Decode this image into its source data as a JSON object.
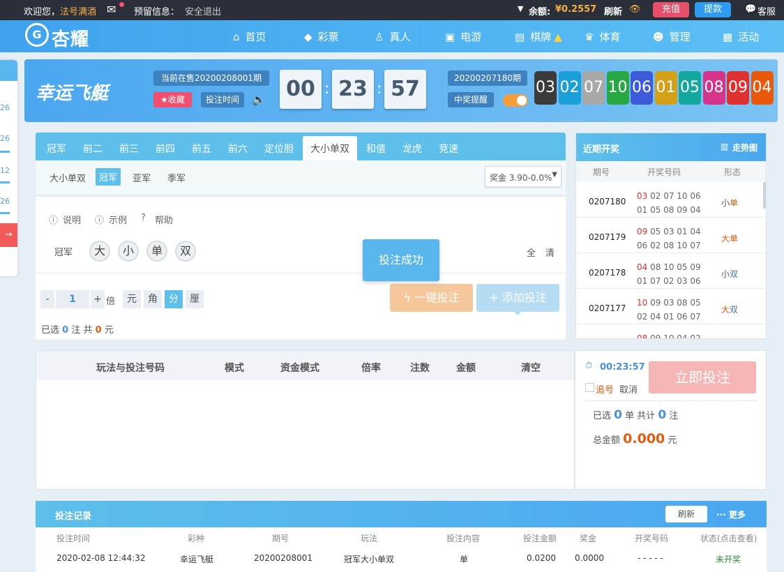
{
  "topbar": {
    "welcome": "欢迎您，",
    "username": "法号满酒",
    "reserved_label": "预留信息：",
    "logout": "安全退出",
    "balance_label": "余额:",
    "balance": "¥0.2557",
    "refresh": "刷新",
    "recharge": "充值",
    "withdraw": "提款",
    "service": "客服"
  },
  "brand": {
    "logo": "杏耀"
  },
  "nav": {
    "items": [
      {
        "label": "首页",
        "icon": "home-icon"
      },
      {
        "label": "彩票",
        "icon": "diamond-icon"
      },
      {
        "label": "真人",
        "icon": "person-icon"
      },
      {
        "label": "电游",
        "icon": "arcade-icon"
      },
      {
        "label": "棋牌",
        "icon": "cards-icon"
      },
      {
        "label": "体育",
        "icon": "trophy-icon"
      },
      {
        "label": "管理",
        "icon": "users-icon"
      },
      {
        "label": "活动",
        "icon": "gift-icon"
      }
    ]
  },
  "side": {
    "values": [
      "26",
      "26",
      "12",
      "26"
    ]
  },
  "game": {
    "title": "幸运飞艇",
    "current_issue": "当前在售20200208001期",
    "favorite": "★收藏",
    "bet_time": "投注时间",
    "countdown": [
      "00",
      "23",
      "57"
    ],
    "last_issue": "20200207180期",
    "win_notice": "中奖提醒",
    "balls": [
      "03",
      "02",
      "07",
      "10",
      "06",
      "01",
      "05",
      "08",
      "09",
      "04"
    ],
    "ball_colors": [
      "#3b3b3b",
      "#1a9fd8",
      "#a8a8a8",
      "#28a745",
      "#3b5bdb",
      "#d4a017",
      "#13a89e",
      "#d6338b",
      "#e03131",
      "#e8590c"
    ]
  },
  "tabs": [
    "冠军",
    "前二",
    "前三",
    "前四",
    "前五",
    "前六",
    "定位胆",
    "大小单双",
    "和值",
    "龙虎",
    "竞速"
  ],
  "subtabs": [
    "大小单双",
    "冠军",
    "亚军",
    "季军"
  ],
  "prize_select": "奖金 3.90-0.0%",
  "helpers": [
    "说明",
    "示例",
    "帮助"
  ],
  "bet": {
    "position_label": "冠军",
    "options": [
      "大",
      "小",
      "单",
      "双"
    ],
    "all": "全",
    "clear": "清",
    "multiplier": "1",
    "multiplier_label": "倍",
    "units": [
      "元",
      "角",
      "分",
      "厘"
    ],
    "selected_prefix": "已选",
    "selected_count": "0",
    "selected_unit": "注",
    "total_prefix": "共",
    "total_amount": "0",
    "total_unit": "元",
    "one_click": "一键投注",
    "add_bet": "添加投注",
    "toast": "投注成功"
  },
  "history": {
    "title": "近期开奖",
    "trend": "走势图",
    "headers": [
      "期号",
      "开奖号码",
      "形态"
    ],
    "rows": [
      {
        "issue": "0207180",
        "first": "03",
        "rest": "02 07 10 06 01 05 08 09 04",
        "shape_a": "小",
        "shape_b": "单"
      },
      {
        "issue": "0207179",
        "first": "09",
        "rest": "05 03 01 04 06 02 08 10 07",
        "shape_a": "大",
        "shape_b": "单"
      },
      {
        "issue": "0207178",
        "first": "04",
        "rest": "08 10 05 09 01 07 02 03 06",
        "shape_a": "小",
        "shape_b": "双"
      },
      {
        "issue": "0207177",
        "first": "10",
        "rest": "09 03 08 05 02 04 01 06 07",
        "shape_a": "大",
        "shape_b": "双"
      },
      {
        "issue": "",
        "first": "08",
        "rest": "09 10 04 02",
        "shape_a": "",
        "shape_b": ""
      }
    ]
  },
  "cart": {
    "headers": [
      "玩法与投注号码",
      "模式",
      "资金模式",
      "倍率",
      "注数",
      "金额",
      "清空"
    ],
    "timer": "00:23:57",
    "chase": "追号",
    "cancel": "取消",
    "submit": "立即投注",
    "selected_prefix": "已选",
    "selected_count": "0",
    "selected_mid": "单 共计",
    "selected_total": "0",
    "selected_unit": "注",
    "amount_label": "总金额",
    "amount": "0.000",
    "amount_unit": "元"
  },
  "records": {
    "title": "投注记录",
    "refresh": "刷新",
    "more": "··· 更多",
    "headers": [
      "投注时间",
      "彩种",
      "期号",
      "玩法",
      "投注内容",
      "投注金额",
      "奖金",
      "开奖号码",
      "状态(点击查看)"
    ],
    "row": [
      "2020-02-08 12:44:32",
      "幸运飞艇",
      "20200208001",
      "冠军大小单双",
      "单",
      "0.0200",
      "0.0000",
      "- - - - -",
      "未开奖"
    ]
  }
}
